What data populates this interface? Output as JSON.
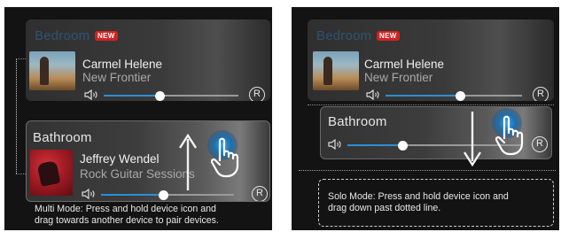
{
  "colors": {
    "accent": "#2b8fd6",
    "new_badge": "#d62020",
    "panel_bg": "#131313",
    "card_bg": "#333333"
  },
  "left": {
    "top_card": {
      "room": "Bedroom",
      "badge": "NEW",
      "artist": "Carmel Helene",
      "album": "New Frontier",
      "volume_fraction": 0.42,
      "repeat_label": "R"
    },
    "bottom_card": {
      "room": "Bathroom",
      "artist": "Jeffrey Wendel",
      "album": "Rock Guitar Sessions",
      "volume_fraction": 0.47,
      "repeat_label": "R"
    },
    "caption_lines": [
      "Multi Mode: Press and hold device icon and",
      "drag towards another device to pair devices."
    ],
    "gesture": {
      "arrow_direction": "up",
      "icons": [
        "hand-pointer-icon",
        "up-arrow-icon",
        "touch-glow-icon"
      ]
    }
  },
  "right": {
    "top_card": {
      "room": "Bedroom",
      "badge": "NEW",
      "artist": "Carmel Helene",
      "album": "New Frontier",
      "volume_fraction": 0.55,
      "repeat_label": "R"
    },
    "bottom_card": {
      "room": "Bathroom",
      "volume_fraction": 0.32,
      "repeat_label": "R"
    },
    "caption_lines": [
      "Solo Mode: Press and hold device icon and",
      "drag down past dotted line."
    ],
    "gesture": {
      "arrow_direction": "down",
      "icons": [
        "hand-pointer-icon",
        "down-arrow-icon",
        "touch-glow-icon"
      ]
    }
  }
}
